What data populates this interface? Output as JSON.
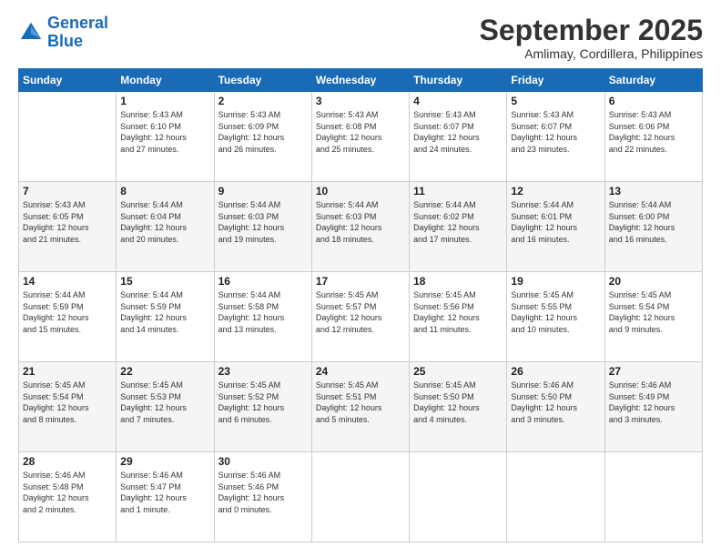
{
  "logo": {
    "line1": "General",
    "line2": "Blue"
  },
  "title": "September 2025",
  "subtitle": "Amlimay, Cordillera, Philippines",
  "days_header": [
    "Sunday",
    "Monday",
    "Tuesday",
    "Wednesday",
    "Thursday",
    "Friday",
    "Saturday"
  ],
  "weeks": [
    [
      {
        "day": "",
        "info": ""
      },
      {
        "day": "1",
        "info": "Sunrise: 5:43 AM\nSunset: 6:10 PM\nDaylight: 12 hours\nand 27 minutes."
      },
      {
        "day": "2",
        "info": "Sunrise: 5:43 AM\nSunset: 6:09 PM\nDaylight: 12 hours\nand 26 minutes."
      },
      {
        "day": "3",
        "info": "Sunrise: 5:43 AM\nSunset: 6:08 PM\nDaylight: 12 hours\nand 25 minutes."
      },
      {
        "day": "4",
        "info": "Sunrise: 5:43 AM\nSunset: 6:07 PM\nDaylight: 12 hours\nand 24 minutes."
      },
      {
        "day": "5",
        "info": "Sunrise: 5:43 AM\nSunset: 6:07 PM\nDaylight: 12 hours\nand 23 minutes."
      },
      {
        "day": "6",
        "info": "Sunrise: 5:43 AM\nSunset: 6:06 PM\nDaylight: 12 hours\nand 22 minutes."
      }
    ],
    [
      {
        "day": "7",
        "info": "Sunrise: 5:43 AM\nSunset: 6:05 PM\nDaylight: 12 hours\nand 21 minutes."
      },
      {
        "day": "8",
        "info": "Sunrise: 5:44 AM\nSunset: 6:04 PM\nDaylight: 12 hours\nand 20 minutes."
      },
      {
        "day": "9",
        "info": "Sunrise: 5:44 AM\nSunset: 6:03 PM\nDaylight: 12 hours\nand 19 minutes."
      },
      {
        "day": "10",
        "info": "Sunrise: 5:44 AM\nSunset: 6:03 PM\nDaylight: 12 hours\nand 18 minutes."
      },
      {
        "day": "11",
        "info": "Sunrise: 5:44 AM\nSunset: 6:02 PM\nDaylight: 12 hours\nand 17 minutes."
      },
      {
        "day": "12",
        "info": "Sunrise: 5:44 AM\nSunset: 6:01 PM\nDaylight: 12 hours\nand 16 minutes."
      },
      {
        "day": "13",
        "info": "Sunrise: 5:44 AM\nSunset: 6:00 PM\nDaylight: 12 hours\nand 16 minutes."
      }
    ],
    [
      {
        "day": "14",
        "info": "Sunrise: 5:44 AM\nSunset: 5:59 PM\nDaylight: 12 hours\nand 15 minutes."
      },
      {
        "day": "15",
        "info": "Sunrise: 5:44 AM\nSunset: 5:59 PM\nDaylight: 12 hours\nand 14 minutes."
      },
      {
        "day": "16",
        "info": "Sunrise: 5:44 AM\nSunset: 5:58 PM\nDaylight: 12 hours\nand 13 minutes."
      },
      {
        "day": "17",
        "info": "Sunrise: 5:45 AM\nSunset: 5:57 PM\nDaylight: 12 hours\nand 12 minutes."
      },
      {
        "day": "18",
        "info": "Sunrise: 5:45 AM\nSunset: 5:56 PM\nDaylight: 12 hours\nand 11 minutes."
      },
      {
        "day": "19",
        "info": "Sunrise: 5:45 AM\nSunset: 5:55 PM\nDaylight: 12 hours\nand 10 minutes."
      },
      {
        "day": "20",
        "info": "Sunrise: 5:45 AM\nSunset: 5:54 PM\nDaylight: 12 hours\nand 9 minutes."
      }
    ],
    [
      {
        "day": "21",
        "info": "Sunrise: 5:45 AM\nSunset: 5:54 PM\nDaylight: 12 hours\nand 8 minutes."
      },
      {
        "day": "22",
        "info": "Sunrise: 5:45 AM\nSunset: 5:53 PM\nDaylight: 12 hours\nand 7 minutes."
      },
      {
        "day": "23",
        "info": "Sunrise: 5:45 AM\nSunset: 5:52 PM\nDaylight: 12 hours\nand 6 minutes."
      },
      {
        "day": "24",
        "info": "Sunrise: 5:45 AM\nSunset: 5:51 PM\nDaylight: 12 hours\nand 5 minutes."
      },
      {
        "day": "25",
        "info": "Sunrise: 5:45 AM\nSunset: 5:50 PM\nDaylight: 12 hours\nand 4 minutes."
      },
      {
        "day": "26",
        "info": "Sunrise: 5:46 AM\nSunset: 5:50 PM\nDaylight: 12 hours\nand 3 minutes."
      },
      {
        "day": "27",
        "info": "Sunrise: 5:46 AM\nSunset: 5:49 PM\nDaylight: 12 hours\nand 3 minutes."
      }
    ],
    [
      {
        "day": "28",
        "info": "Sunrise: 5:46 AM\nSunset: 5:48 PM\nDaylight: 12 hours\nand 2 minutes."
      },
      {
        "day": "29",
        "info": "Sunrise: 5:46 AM\nSunset: 5:47 PM\nDaylight: 12 hours\nand 1 minute."
      },
      {
        "day": "30",
        "info": "Sunrise: 5:46 AM\nSunset: 5:46 PM\nDaylight: 12 hours\nand 0 minutes."
      },
      {
        "day": "",
        "info": ""
      },
      {
        "day": "",
        "info": ""
      },
      {
        "day": "",
        "info": ""
      },
      {
        "day": "",
        "info": ""
      }
    ]
  ]
}
